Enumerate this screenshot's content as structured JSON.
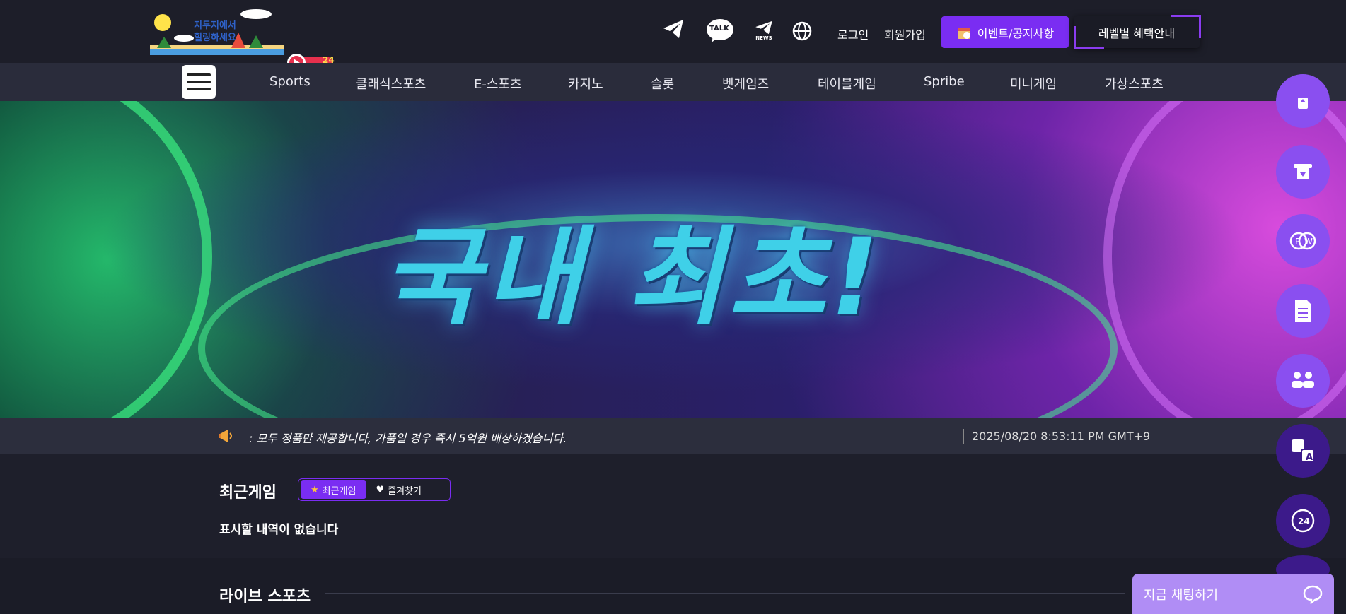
{
  "header": {
    "logo_line1": "지두지에서",
    "logo_line2": "힐링하세요",
    "live_count": "24",
    "icons": [
      "telegram-icon",
      "kakaotalk-icon",
      "telegram-news-icon",
      "globe-language-icon"
    ],
    "talk_label": "TALK",
    "news_label": "NEWS",
    "login_label": "로그인",
    "signup_label": "회원가입",
    "event_label": "이벤트/공지사항",
    "level_label": "레벨별 혜택안내"
  },
  "nav": {
    "items": [
      "Sports",
      "클래식스포츠",
      "E-스포츠",
      "카지노",
      "슬롯",
      "벳게임즈",
      "테이블게임",
      "Spribe",
      "미니게임",
      "가상스포츠"
    ]
  },
  "banner": {
    "title": "국내 최초!"
  },
  "notice": {
    "text": ": 모두 정품만 제공합니다, 가품일 경우 즉시 5억원 배상하겠습니다.",
    "datetime": "2025/08/20 8:53:11 PM GMT+9"
  },
  "recent": {
    "title": "최근게임",
    "tab_recent": "최근게임",
    "tab_favorite": "즐겨찾기",
    "empty_message": "표시할 내역이 없습니다"
  },
  "live_sports": {
    "title": "라이브 스포츠"
  },
  "chat": {
    "label": "지금 채팅하기"
  },
  "colors": {
    "accent": "#7a2df2",
    "side_light": "#8a4ff0",
    "side_dark": "#3c1a8a",
    "chat": "#b08df5"
  }
}
